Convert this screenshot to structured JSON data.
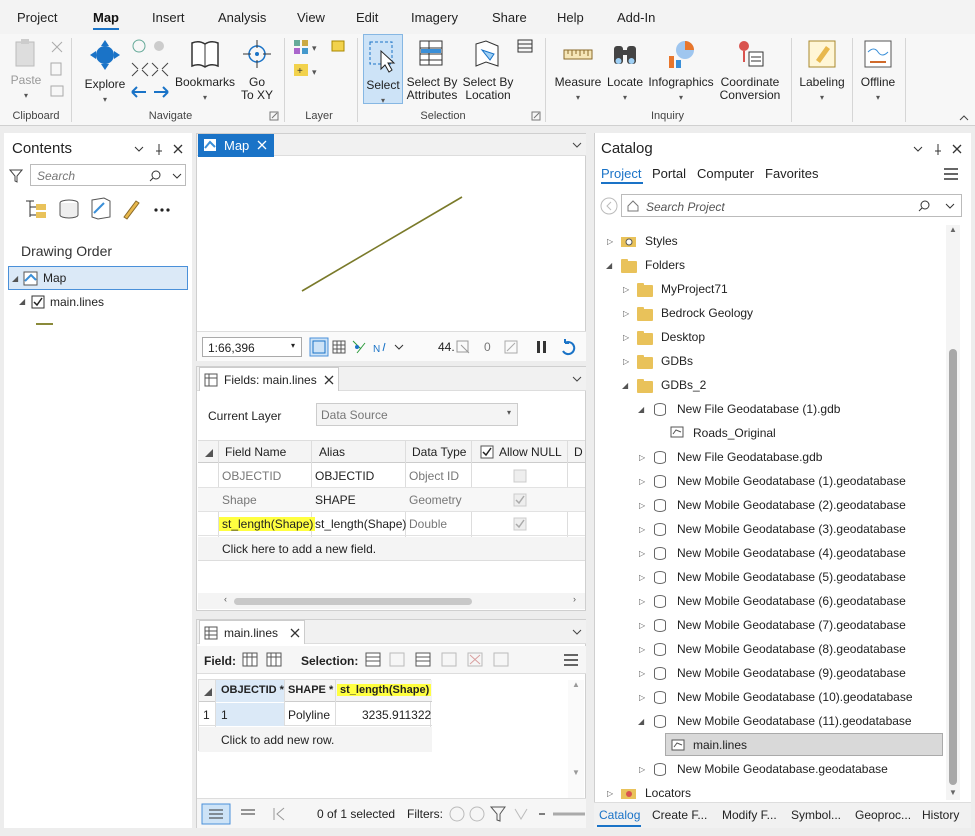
{
  "menu": {
    "tabs": [
      "Project",
      "Map",
      "Insert",
      "Analysis",
      "View",
      "Edit",
      "Imagery",
      "Share",
      "Help",
      "Add-In"
    ]
  },
  "ribbon": {
    "paste": "Paste",
    "explore": "Explore",
    "bookmarks": "Bookmarks",
    "go1": "Go",
    "go2": "To XY",
    "select": "Select",
    "selby_attr1": "Select By",
    "selby_attr2": "Attributes",
    "selby_loc1": "Select By",
    "selby_loc2": "Location",
    "measure": "Measure",
    "locate": "Locate",
    "infographics": "Infographics",
    "coord1": "Coordinate",
    "coord2": "Conversion",
    "labeling": "Labeling",
    "offline": "Offline",
    "groups": {
      "clipboard": "Clipboard",
      "navigate": "Navigate",
      "layer": "Layer",
      "selection": "Selection",
      "inquiry": "Inquiry"
    }
  },
  "contents": {
    "title": "Contents",
    "search_placeholder": "Search",
    "drawing_order": "Drawing Order",
    "map_item": "Map",
    "layer_item": "main.lines"
  },
  "map_view": {
    "tab": "Map",
    "scale": "1:66,396",
    "coord_value": "44.",
    "sel_count": "0"
  },
  "fields_view": {
    "tab": "Fields: main.lines",
    "current_layer_label": "Current Layer",
    "data_source": "Data Source",
    "columns": [
      "Field Name",
      "Alias",
      "Data Type",
      "Allow NULL",
      "D"
    ],
    "rows": [
      [
        "OBJECTID",
        "OBJECTID",
        "Object ID"
      ],
      [
        "Shape",
        "SHAPE",
        "Geometry"
      ],
      [
        "st_length(Shape)",
        "st_length(Shape)",
        "Double"
      ]
    ],
    "add_field": "Click here to add a new field."
  },
  "table_view": {
    "tab": "main.lines",
    "field_label": "Field:",
    "selection_label": "Selection:",
    "columns": [
      "OBJECTID *",
      "SHAPE *",
      "st_length(Shape)"
    ],
    "row_num": "1",
    "row": [
      "1",
      "Polyline",
      "3235.911322"
    ],
    "add_row": "Click to add new row.",
    "status": "0 of 1 selected",
    "filters": "Filters:"
  },
  "catalog": {
    "title": "Catalog",
    "tabs": [
      "Project",
      "Portal",
      "Computer",
      "Favorites"
    ],
    "search_placeholder": "Search Project",
    "items": [
      "Styles",
      "Folders",
      "MyProject71",
      "Bedrock Geology",
      "Desktop",
      "GDBs",
      "GDBs_2",
      "New File Geodatabase (1).gdb",
      "Roads_Original",
      "New File Geodatabase.gdb",
      "New Mobile Geodatabase (1).geodatabase",
      "New Mobile Geodatabase (2).geodatabase",
      "New Mobile Geodatabase (3).geodatabase",
      "New Mobile Geodatabase (4).geodatabase",
      "New Mobile Geodatabase (5).geodatabase",
      "New Mobile Geodatabase (6).geodatabase",
      "New Mobile Geodatabase (7).geodatabase",
      "New Mobile Geodatabase (8).geodatabase",
      "New Mobile Geodatabase (9).geodatabase",
      "New Mobile Geodatabase (10).geodatabase",
      "New Mobile Geodatabase (11).geodatabase",
      "main.lines",
      "New Mobile Geodatabase.geodatabase",
      "Locators"
    ],
    "bottom_tabs": [
      "Catalog",
      "Create F...",
      "Modify F...",
      "Symbol...",
      "Geoproc...",
      "History"
    ]
  },
  "colors": {
    "accent": "#1a73c7",
    "highlight": "#ffff40",
    "selected": "#dbe9f7"
  }
}
